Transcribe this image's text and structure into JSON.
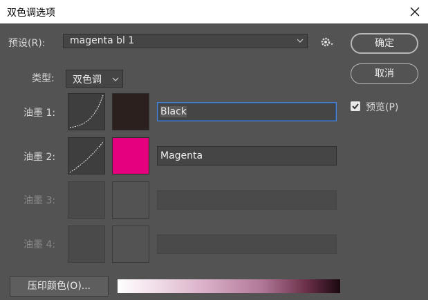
{
  "window": {
    "title": "双色调选项"
  },
  "preset": {
    "label": "预设(R):",
    "value": "magenta bl 1"
  },
  "type": {
    "label": "类型:",
    "value": "双色调"
  },
  "buttons": {
    "ok": "确定",
    "cancel": "取消",
    "overprint": "压印颜色(O)..."
  },
  "preview": {
    "label": "预览(P)",
    "checked": true
  },
  "inks": [
    {
      "label": "油墨 1:",
      "name": "Black",
      "color": "#2b201d",
      "enabled": true
    },
    {
      "label": "油墨 2:",
      "name": "Magenta",
      "color": "#e4007f",
      "enabled": true
    },
    {
      "label": "油墨 3:",
      "name": "",
      "enabled": false
    },
    {
      "label": "油墨 4:",
      "name": "",
      "enabled": false
    }
  ],
  "icons": [
    "close-icon",
    "chevron-down-icon",
    "gear-icon",
    "checkmark-icon"
  ]
}
